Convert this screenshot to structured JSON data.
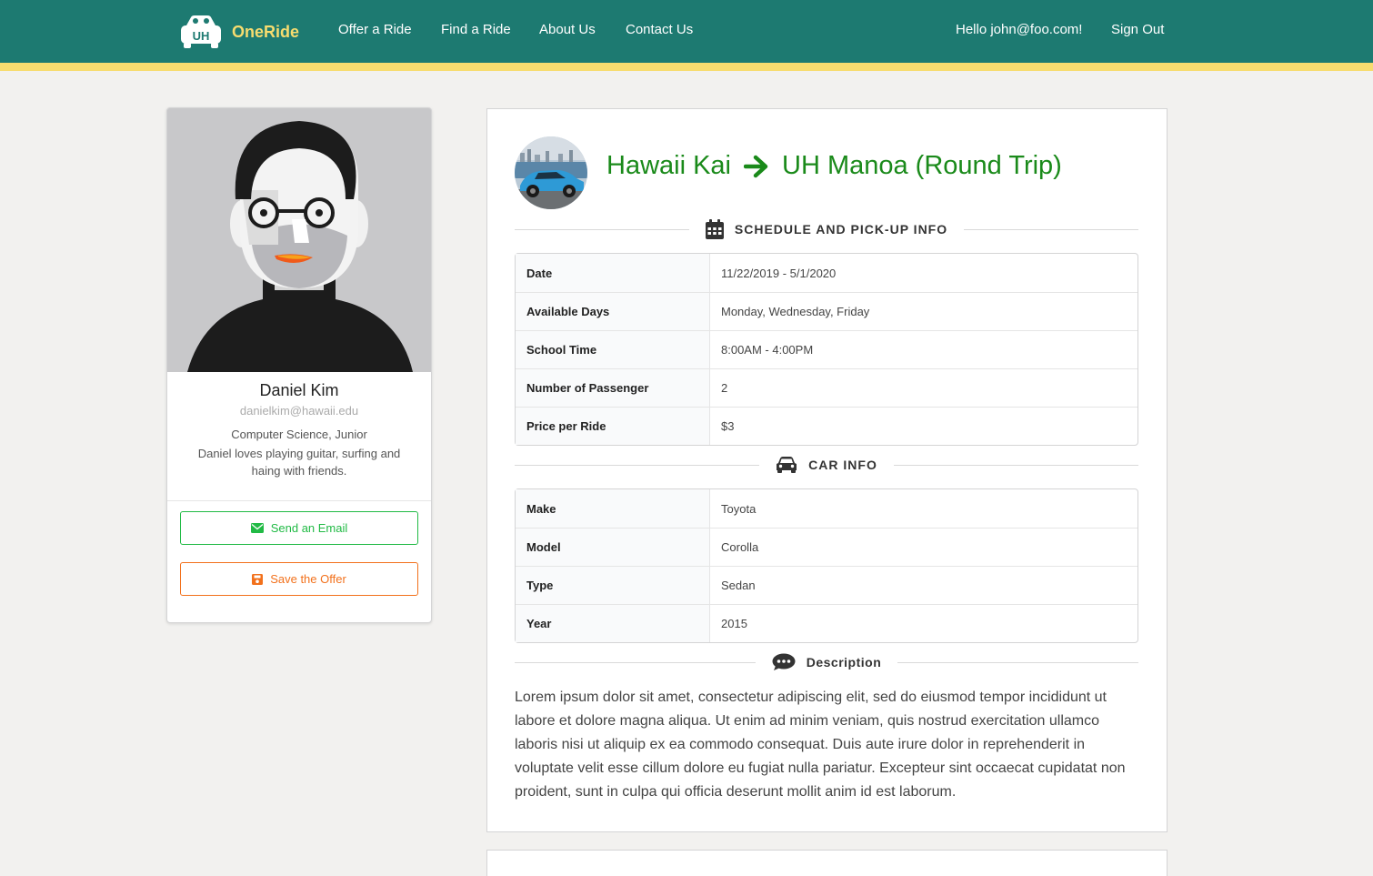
{
  "brand": {
    "prefix": "One",
    "name": "Ride",
    "logo_text": "UH"
  },
  "nav": {
    "offer_ride": "Offer a Ride",
    "find_ride": "Find a Ride",
    "about": "About Us",
    "contact": "Contact Us",
    "greeting": "Hello john@foo.com!",
    "sign_out": "Sign Out"
  },
  "profile": {
    "name": "Daniel Kim",
    "email": "danielkim@hawaii.edu",
    "major": "Computer Science, Junior",
    "bio": "Daniel loves playing guitar, surfing and haing with friends.",
    "email_button": "Send an Email",
    "save_button": "Save the Offer"
  },
  "ride": {
    "origin": "Hawaii Kai",
    "destination": "UH Manoa (Round Trip)",
    "schedule_header": "SCHEDULE AND PICK-UP INFO",
    "schedule": [
      {
        "label": "Date",
        "value": "11/22/2019 - 5/1/2020"
      },
      {
        "label": "Available Days",
        "value": "Monday, Wednesday, Friday"
      },
      {
        "label": "School Time",
        "value": "8:00AM - 4:00PM"
      },
      {
        "label": "Number of Passenger",
        "value": "2"
      },
      {
        "label": "Price per Ride",
        "value": "$3"
      }
    ],
    "car_header": "CAR INFO",
    "car": [
      {
        "label": "Make",
        "value": "Toyota"
      },
      {
        "label": "Model",
        "value": "Corolla"
      },
      {
        "label": "Type",
        "value": "Sedan"
      },
      {
        "label": "Year",
        "value": "2015"
      }
    ],
    "description_header": "Description",
    "description": "Lorem ipsum dolor sit amet, consectetur adipiscing elit, sed do eiusmod tempor incididunt ut labore et dolore magna aliqua. Ut enim ad minim veniam, quis nostrud exercitation ullamco laboris nisi ut aliquip ex ea commodo consequat. Duis aute irure dolor in reprehenderit in voluptate velit esse cillum dolore eu fugiat nulla pariatur. Excepteur sint occaecat cupidatat non proident, sunt in culpa qui officia deserunt mollit anim id est laborum."
  },
  "colors": {
    "navbar": "#1d7a71",
    "stripe": "#f7dc6f",
    "route_title": "#1a8a1a",
    "email_button": "#21ba45",
    "save_button": "#f2711c"
  },
  "icons": {
    "logo": "car-logo-icon",
    "arrow": "arrow-right-icon",
    "calendar": "calendar-icon",
    "car": "car-icon",
    "comments": "comments-icon",
    "envelope": "envelope-icon",
    "save": "save-icon"
  }
}
